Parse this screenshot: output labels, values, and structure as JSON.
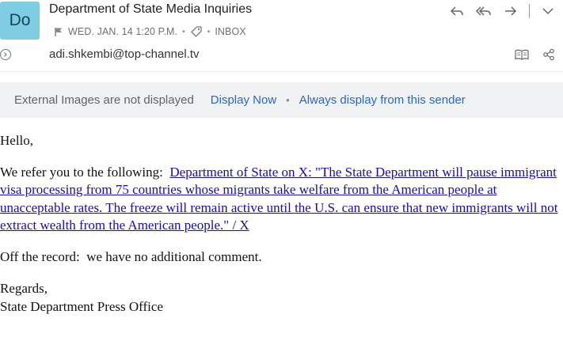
{
  "header": {
    "avatar_initials": "Do",
    "sender_name": "Department of State Media Inquiries",
    "date": "WED. JAN. 14 1:20 P.M.",
    "folder": "INBOX",
    "sender_email": "adi.shkembi@top-channel.tv",
    "icons": {
      "flag": "flag-icon",
      "tag": "tag-icon",
      "reply": "reply-icon",
      "reply_all": "reply-all-icon",
      "forward": "forward-icon",
      "more": "chevron-down-icon",
      "expand": "expand-circle-icon",
      "reader": "book-open-icon",
      "share": "share-icon"
    }
  },
  "banner": {
    "message": "External Images are not displayed",
    "display_now": "Display Now",
    "separator": "•",
    "always_display": "Always display from this sender"
  },
  "body": {
    "greeting": "Hello,",
    "refer_text": "We refer you to the following:  ",
    "link_text": "Department of State on X: \"The State Department will pause immigrant visa processing from 75 countries whose migrants take welfare from the American people at unacceptable rates. The freeze will remain active until the U.S. can ensure that new immigrants will not extract wealth from the American people.\" / X",
    "off_record": "Off the record:  we have no additional comment.",
    "closing": "Regards,",
    "signature": "State Department Press Office"
  },
  "colors": {
    "avatar_bg": "#7fcde3",
    "link": "#2c66c4",
    "banner_bg": "#f1f2f4"
  }
}
